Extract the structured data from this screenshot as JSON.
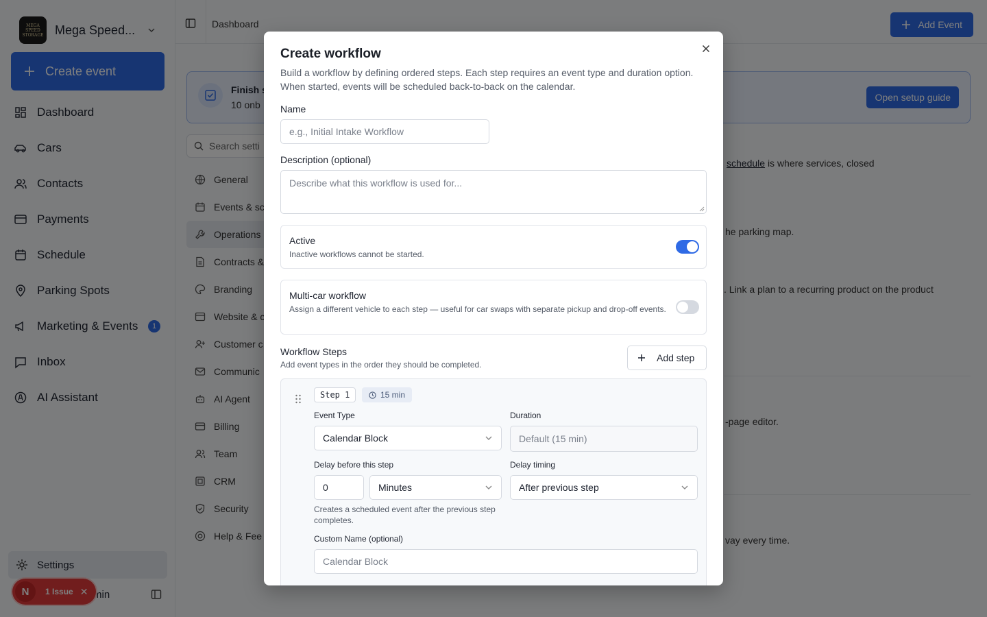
{
  "org": {
    "name": "Mega Speed...",
    "logo_text": "MEGA SPEED STORAGE"
  },
  "sidebar": {
    "create_label": "Create event",
    "items": [
      {
        "label": "Dashboard",
        "icon": "dashboard-icon"
      },
      {
        "label": "Cars",
        "icon": "car-icon"
      },
      {
        "label": "Contacts",
        "icon": "contacts-icon"
      },
      {
        "label": "Payments",
        "icon": "card-icon"
      },
      {
        "label": "Schedule",
        "icon": "calendar-icon"
      },
      {
        "label": "Parking Spots",
        "icon": "pin-icon"
      },
      {
        "label": "Marketing & Events",
        "icon": "megaphone-icon",
        "badge": "1"
      },
      {
        "label": "Inbox",
        "icon": "inbox-icon"
      },
      {
        "label": "AI Assistant",
        "icon": "ai-icon"
      }
    ],
    "settings_label": "Settings",
    "user_name_fragment": "min",
    "issue": {
      "avatar": "N",
      "label": "1 Issue",
      "close": "✕"
    }
  },
  "topbar": {
    "breadcrumb": "Dashboard",
    "add_event_label": "Add Event"
  },
  "onboarding": {
    "title_fragment": "Finish s",
    "subtitle_fragment": "10 onb",
    "button_label": "Open setup guide"
  },
  "settings_nav": {
    "search_placeholder": "Search setti",
    "items": [
      "General",
      "Events & sc",
      "Operations",
      "Contracts &",
      "Branding",
      "Website & c",
      "Customer c",
      "Communic",
      "AI Agent",
      "Billing",
      "Team",
      "CRM",
      "Security",
      "Help & Fee"
    ],
    "active_index": 2
  },
  "background_text": {
    "schedule_link": "schedule",
    "schedule_rest": "is where services, closed",
    "parking": "he parking map.",
    "plan": ". Link a plan to a recurring product on the product",
    "editor": "-page editor.",
    "every": "vay every time."
  },
  "modal": {
    "title": "Create workflow",
    "description": "Build a workflow by defining ordered steps. Each step requires an event type and duration option. When started, events will be scheduled back-to-back on the calendar.",
    "name_label": "Name",
    "name_placeholder": "e.g., Initial Intake Workflow",
    "desc_label": "Description (optional)",
    "desc_placeholder": "Describe what this workflow is used for...",
    "active": {
      "title": "Active",
      "subtitle": "Inactive workflows cannot be started.",
      "enabled": true
    },
    "multicar": {
      "title": "Multi-car workflow",
      "subtitle": "Assign a different vehicle to each step — useful for car swaps with separate pickup and drop-off events.",
      "enabled": false
    },
    "steps_title": "Workflow Steps",
    "steps_subtitle": "Add event types in the order they should be completed.",
    "add_step_label": "Add step",
    "step": {
      "badge": "Step 1",
      "duration_badge": "15 min",
      "event_type_label": "Event Type",
      "event_type_value": "Calendar Block",
      "duration_label": "Duration",
      "duration_value": "Default (15 min)",
      "delay_label": "Delay before this step",
      "delay_amount": "0",
      "delay_unit": "Minutes",
      "delay_timing_label": "Delay timing",
      "delay_timing_value": "After previous step",
      "help": "Creates a scheduled event after the previous step completes.",
      "custom_name_label": "Custom Name (optional)",
      "custom_name_placeholder": "Calendar Block"
    }
  },
  "colors": {
    "accent": "#2f6ae5",
    "issue": "#e23b3b"
  }
}
